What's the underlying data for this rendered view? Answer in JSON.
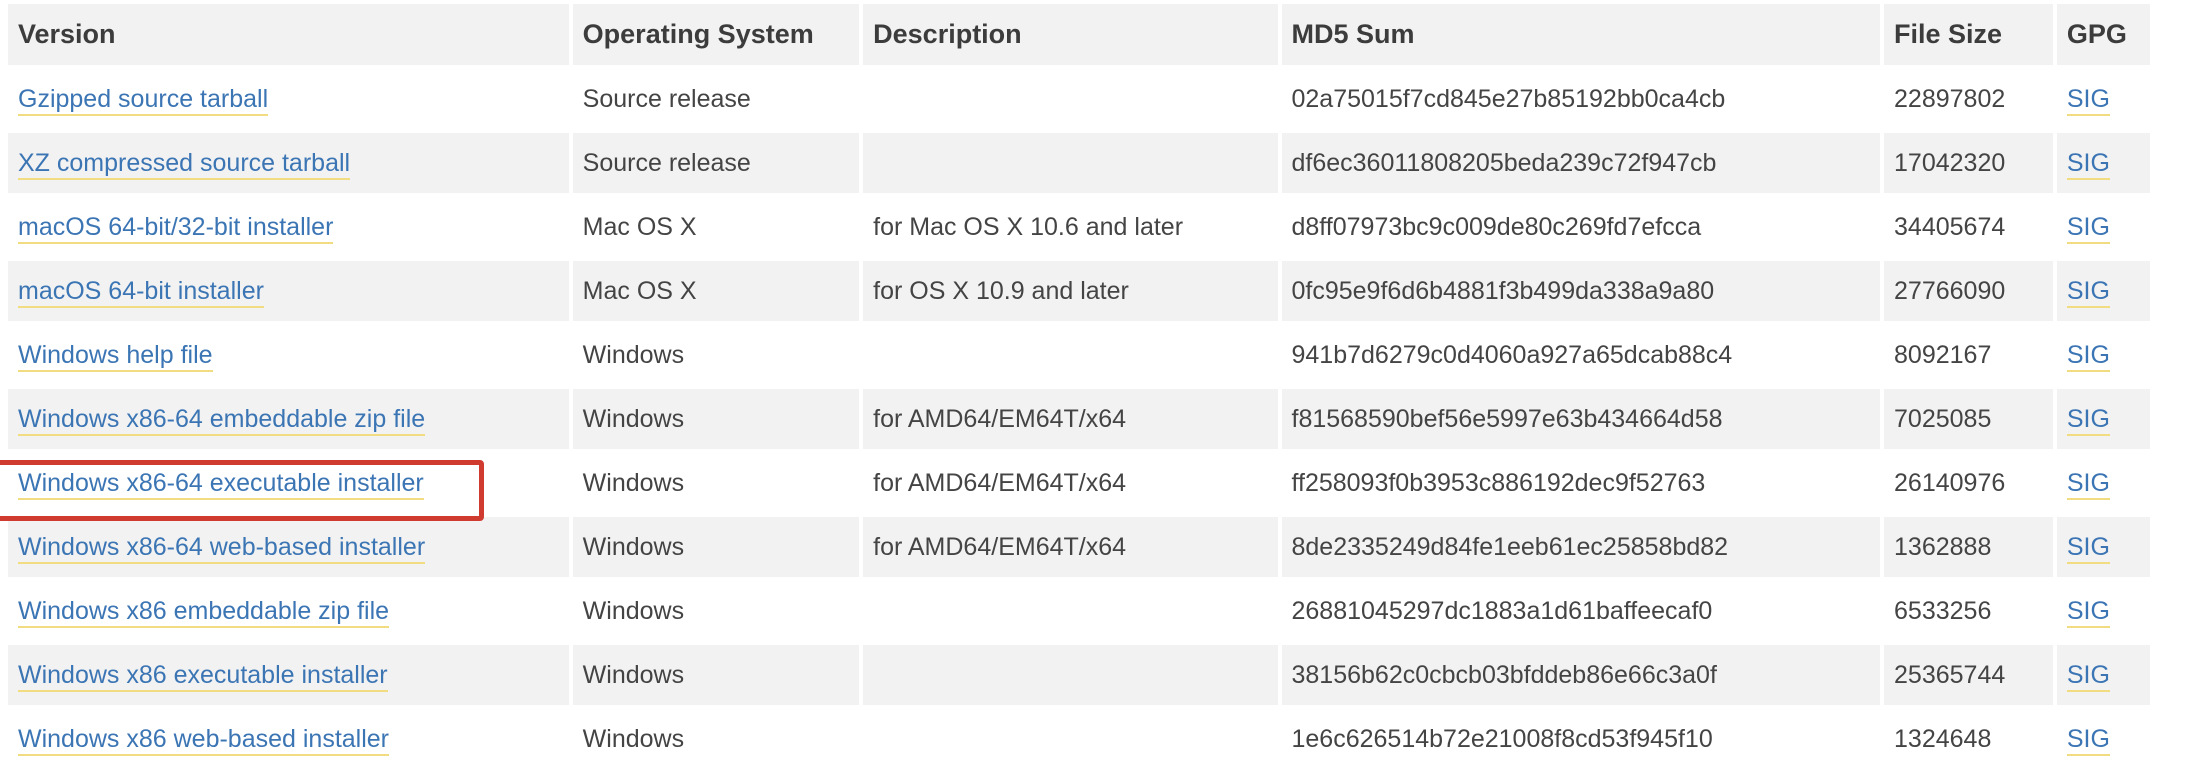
{
  "headers": {
    "version": "Version",
    "os": "Operating System",
    "description": "Description",
    "md5": "MD5 Sum",
    "size": "File Size",
    "gpg": "GPG"
  },
  "rows": [
    {
      "version": "Gzipped source tarball",
      "os": "Source release",
      "description": "",
      "md5": "02a75015f7cd845e27b85192bb0ca4cb",
      "size": "22897802",
      "gpg": "SIG"
    },
    {
      "version": "XZ compressed source tarball",
      "os": "Source release",
      "description": "",
      "md5": "df6ec36011808205beda239c72f947cb",
      "size": "17042320",
      "gpg": "SIG"
    },
    {
      "version": "macOS 64-bit/32-bit installer",
      "os": "Mac OS X",
      "description": "for Mac OS X 10.6 and later",
      "md5": "d8ff07973bc9c009de80c269fd7efcca",
      "size": "34405674",
      "gpg": "SIG"
    },
    {
      "version": "macOS 64-bit installer",
      "os": "Mac OS X",
      "description": "for OS X 10.9 and later",
      "md5": "0fc95e9f6d6b4881f3b499da338a9a80",
      "size": "27766090",
      "gpg": "SIG"
    },
    {
      "version": "Windows help file",
      "os": "Windows",
      "description": "",
      "md5": "941b7d6279c0d4060a927a65dcab88c4",
      "size": "8092167",
      "gpg": "SIG"
    },
    {
      "version": "Windows x86-64 embeddable zip file",
      "os": "Windows",
      "description": "for AMD64/EM64T/x64",
      "md5": "f81568590bef56e5997e63b434664d58",
      "size": "7025085",
      "gpg": "SIG"
    },
    {
      "version": "Windows x86-64 executable installer",
      "os": "Windows",
      "description": "for AMD64/EM64T/x64",
      "md5": "ff258093f0b3953c886192dec9f52763",
      "size": "26140976",
      "gpg": "SIG"
    },
    {
      "version": "Windows x86-64 web-based installer",
      "os": "Windows",
      "description": "for AMD64/EM64T/x64",
      "md5": "8de2335249d84fe1eeb61ec25858bd82",
      "size": "1362888",
      "gpg": "SIG"
    },
    {
      "version": "Windows x86 embeddable zip file",
      "os": "Windows",
      "description": "",
      "md5": "26881045297dc1883a1d61baffeecaf0",
      "size": "6533256",
      "gpg": "SIG"
    },
    {
      "version": "Windows x86 executable installer",
      "os": "Windows",
      "description": "",
      "md5": "38156b62c0cbcb03bfddeb86e66c3a0f",
      "size": "25365744",
      "gpg": "SIG"
    },
    {
      "version": "Windows x86 web-based installer",
      "os": "Windows",
      "description": "",
      "md5": "1e6c626514b72e21008f8cd53f945f10",
      "size": "1324648",
      "gpg": "SIG"
    }
  ],
  "highlighted_row": 6,
  "colors": {
    "link": "#3b75b4",
    "link_underline": "#f1dc82",
    "highlight_border": "#d03b2f",
    "stripe": "#f2f2f2"
  }
}
